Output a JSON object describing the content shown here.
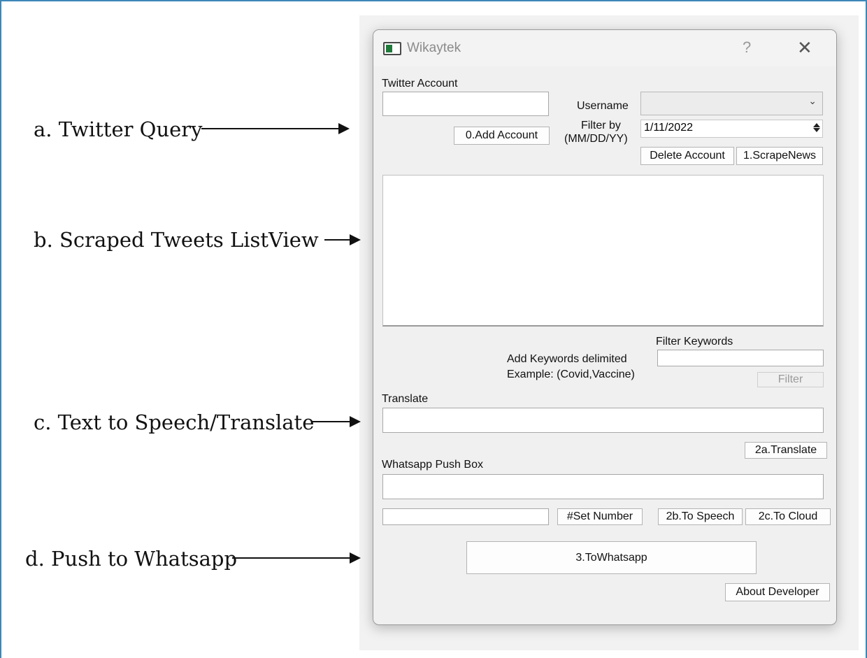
{
  "annotations": {
    "a": "a.  Twitter Query",
    "b": "b.  Scraped Tweets ListView",
    "c": "c. Text to Speech/Translate",
    "d": "d. Push to Whatsapp"
  },
  "window": {
    "title": "Wikaytek",
    "help": "?",
    "close": "✕"
  },
  "twitter": {
    "section_label": "Twitter Account",
    "account_input": "",
    "add_account": "0.Add Account",
    "username_label": "Username",
    "username_value": "",
    "filter_by_label": "Filter by",
    "date_format": "(MM/DD/YY)",
    "date_value": "1/11/2022",
    "delete_account": "Delete Account",
    "scrape_news": "1.ScrapeNews"
  },
  "filter": {
    "title": "Filter Keywords",
    "hint_line1": "Add Keywords delimited",
    "hint_line2": "Example: (Covid,Vaccine)",
    "keywords_value": "",
    "button": "Filter"
  },
  "translate": {
    "label": "Translate",
    "value": "",
    "button": "2a.Translate"
  },
  "whatsapp": {
    "label": "Whatsapp Push Box",
    "message_value": "",
    "number_value": "",
    "set_number": "#Set Number",
    "to_speech": "2b.To Speech",
    "to_cloud": "2c.To Cloud",
    "to_whatsapp": "3.ToWhatsapp",
    "about": "About Developer"
  },
  "icons": {
    "app": "app-window-icon",
    "dropdown": "chevron-down-icon",
    "spinner": "spin-arrows-icon"
  }
}
